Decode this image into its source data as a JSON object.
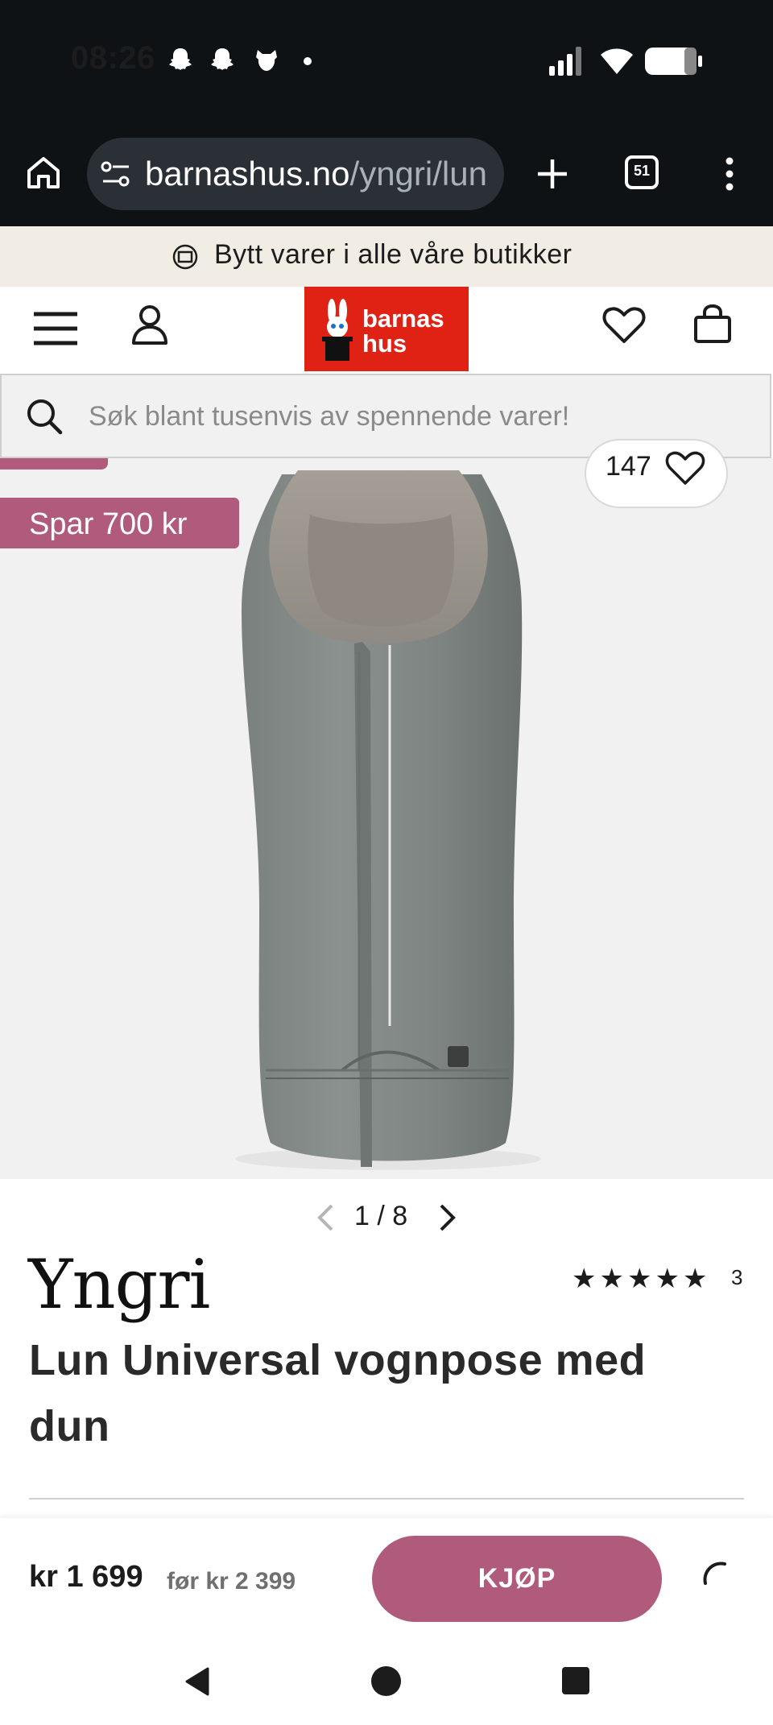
{
  "status_bar": {
    "time": "08:26",
    "notification_icons": [
      "snapchat-icon",
      "snapchat-icon",
      "dog-icon",
      "dot-icon"
    ],
    "system_icons": [
      "signal-icon",
      "wifi-icon",
      "battery-icon"
    ]
  },
  "browser": {
    "url_host": "barnashus.no",
    "url_path": "/yngri/lun",
    "tab_count": "51"
  },
  "promo_banner": {
    "text": "Bytt varer i alle våre butikker",
    "icon": "exchange-icon"
  },
  "header": {
    "logo_line1": "barnas",
    "logo_line2": "hus",
    "brand_color": "#e02214"
  },
  "search": {
    "placeholder": "Søk blant tusenvis av spennende varer!"
  },
  "gallery": {
    "discount_badge": "Spar 700 kr",
    "likes": "147",
    "current": "1",
    "separator": "/",
    "total": "8"
  },
  "product": {
    "brand": "Yngri",
    "rating_stars": 5,
    "rating_count": "3",
    "title": "Lun Universal vognpose med dun"
  },
  "buy_bar": {
    "price": "kr 1 699",
    "old_price": "før kr 2 399",
    "buy_label": "KJØP"
  },
  "colors": {
    "accent": "#b15b7c",
    "brand_red": "#e02214",
    "product_gray": "#7c837f"
  }
}
